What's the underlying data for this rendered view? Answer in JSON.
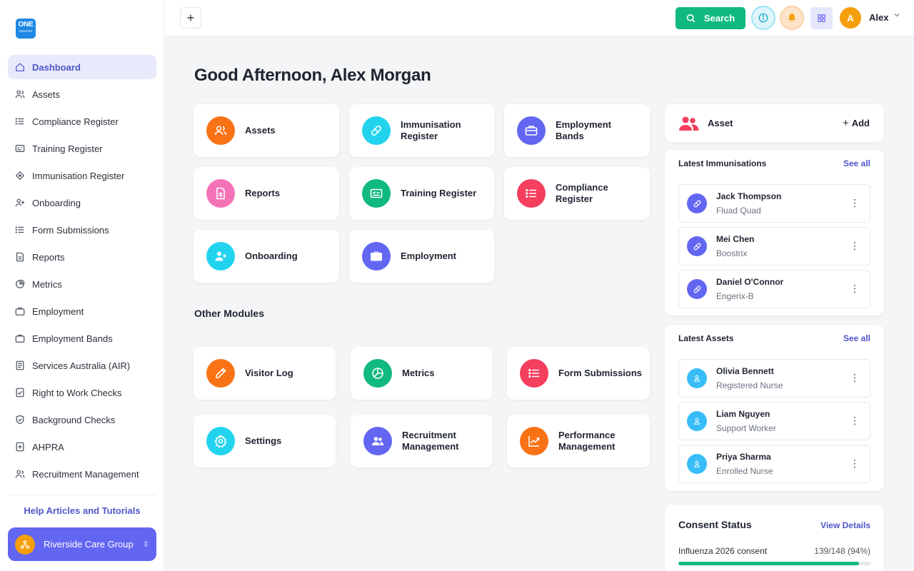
{
  "brand": {
    "logo_top": "ONE",
    "logo_bottom": "PASSPORT"
  },
  "sidebar": {
    "items": [
      {
        "label": "Dashboard",
        "icon": "home-icon",
        "active": true
      },
      {
        "label": "Assets",
        "icon": "users-icon"
      },
      {
        "label": "Compliance Register",
        "icon": "list-icon"
      },
      {
        "label": "Training Register",
        "icon": "id-card-icon"
      },
      {
        "label": "Immunisation Register",
        "icon": "diamond-icon"
      },
      {
        "label": "Onboarding",
        "icon": "user-plus-icon"
      },
      {
        "label": "Form Submissions",
        "icon": "list-icon"
      },
      {
        "label": "Reports",
        "icon": "file-icon"
      },
      {
        "label": "Metrics",
        "icon": "pie-icon"
      },
      {
        "label": "Employment",
        "icon": "briefcase-icon"
      },
      {
        "label": "Employment Bands",
        "icon": "briefcase-icon"
      },
      {
        "label": "Services Australia (AIR)",
        "icon": "document-icon"
      },
      {
        "label": "Right to Work Checks",
        "icon": "check-file-icon"
      },
      {
        "label": "Background Checks",
        "icon": "shield-check-icon"
      },
      {
        "label": "AHPRA",
        "icon": "plus-file-icon"
      },
      {
        "label": "Recruitment Management",
        "icon": "users-icon"
      }
    ],
    "help_link": "Help Articles and Tutorials",
    "org_name": "Riverside Care Group"
  },
  "header": {
    "search_label": "Search",
    "user_initial": "A",
    "user_name": "Alex"
  },
  "main": {
    "greeting": "Good Afternoon, Alex Morgan",
    "modules": [
      {
        "label": "Assets",
        "icon": "users-icon",
        "color": "#f97316"
      },
      {
        "label": "Immunisation Register",
        "icon": "pill-icon",
        "color": "#22d3ee"
      },
      {
        "label": "Employment Bands",
        "icon": "briefcase-icon",
        "color": "#6366f1"
      },
      {
        "label": "Reports",
        "icon": "report-icon",
        "color": "#f472b6"
      },
      {
        "label": "Training Register",
        "icon": "id-card-icon",
        "color": "#10b981"
      },
      {
        "label": "Compliance Register",
        "icon": "list-icon",
        "color": "#f43f5e"
      },
      {
        "label": "Onboarding",
        "icon": "user-plus-icon",
        "color": "#22d3ee"
      },
      {
        "label": "Employment",
        "icon": "briefcase-icon",
        "color": "#6366f1"
      }
    ],
    "other_title": "Other Modules",
    "other_modules": [
      {
        "label": "Visitor Log",
        "icon": "pencil-icon",
        "color": "#f97316"
      },
      {
        "label": "Metrics",
        "icon": "pie-icon",
        "color": "#10b981"
      },
      {
        "label": "Form Submissions",
        "icon": "list-icon",
        "color": "#f43f5e"
      },
      {
        "label": "Settings",
        "icon": "gear-icon",
        "color": "#22d3ee"
      },
      {
        "label": "Recruitment Management",
        "icon": "users-icon",
        "color": "#6366f1"
      },
      {
        "label": "Performance Management",
        "icon": "chart-icon",
        "color": "#f97316"
      }
    ]
  },
  "right": {
    "asset_title": "Asset",
    "add_label": "Add",
    "immunisations": {
      "title": "Latest Immunisations",
      "see_all": "See all",
      "items": [
        {
          "name": "Jack Thompson",
          "sub": "Fluad Quad"
        },
        {
          "name": "Mei Chen",
          "sub": "Boostrix"
        },
        {
          "name": "Daniel O'Connor",
          "sub": "Engerix-B"
        }
      ]
    },
    "assets": {
      "title": "Latest Assets",
      "see_all": "See all",
      "items": [
        {
          "name": "Olivia Bennett",
          "sub": "Registered Nurse"
        },
        {
          "name": "Liam Nguyen",
          "sub": "Support Worker"
        },
        {
          "name": "Priya Sharma",
          "sub": "Enrolled Nurse"
        }
      ]
    },
    "consent": {
      "title": "Consent Status",
      "link": "View Details",
      "row_label": "Influenza 2026 consent",
      "row_value": "139/148 (94%)",
      "progress": 0.94
    }
  },
  "colors": {
    "accent": "#4f56c8",
    "primary_button": "#10b981",
    "org_button": "#6366f1"
  }
}
